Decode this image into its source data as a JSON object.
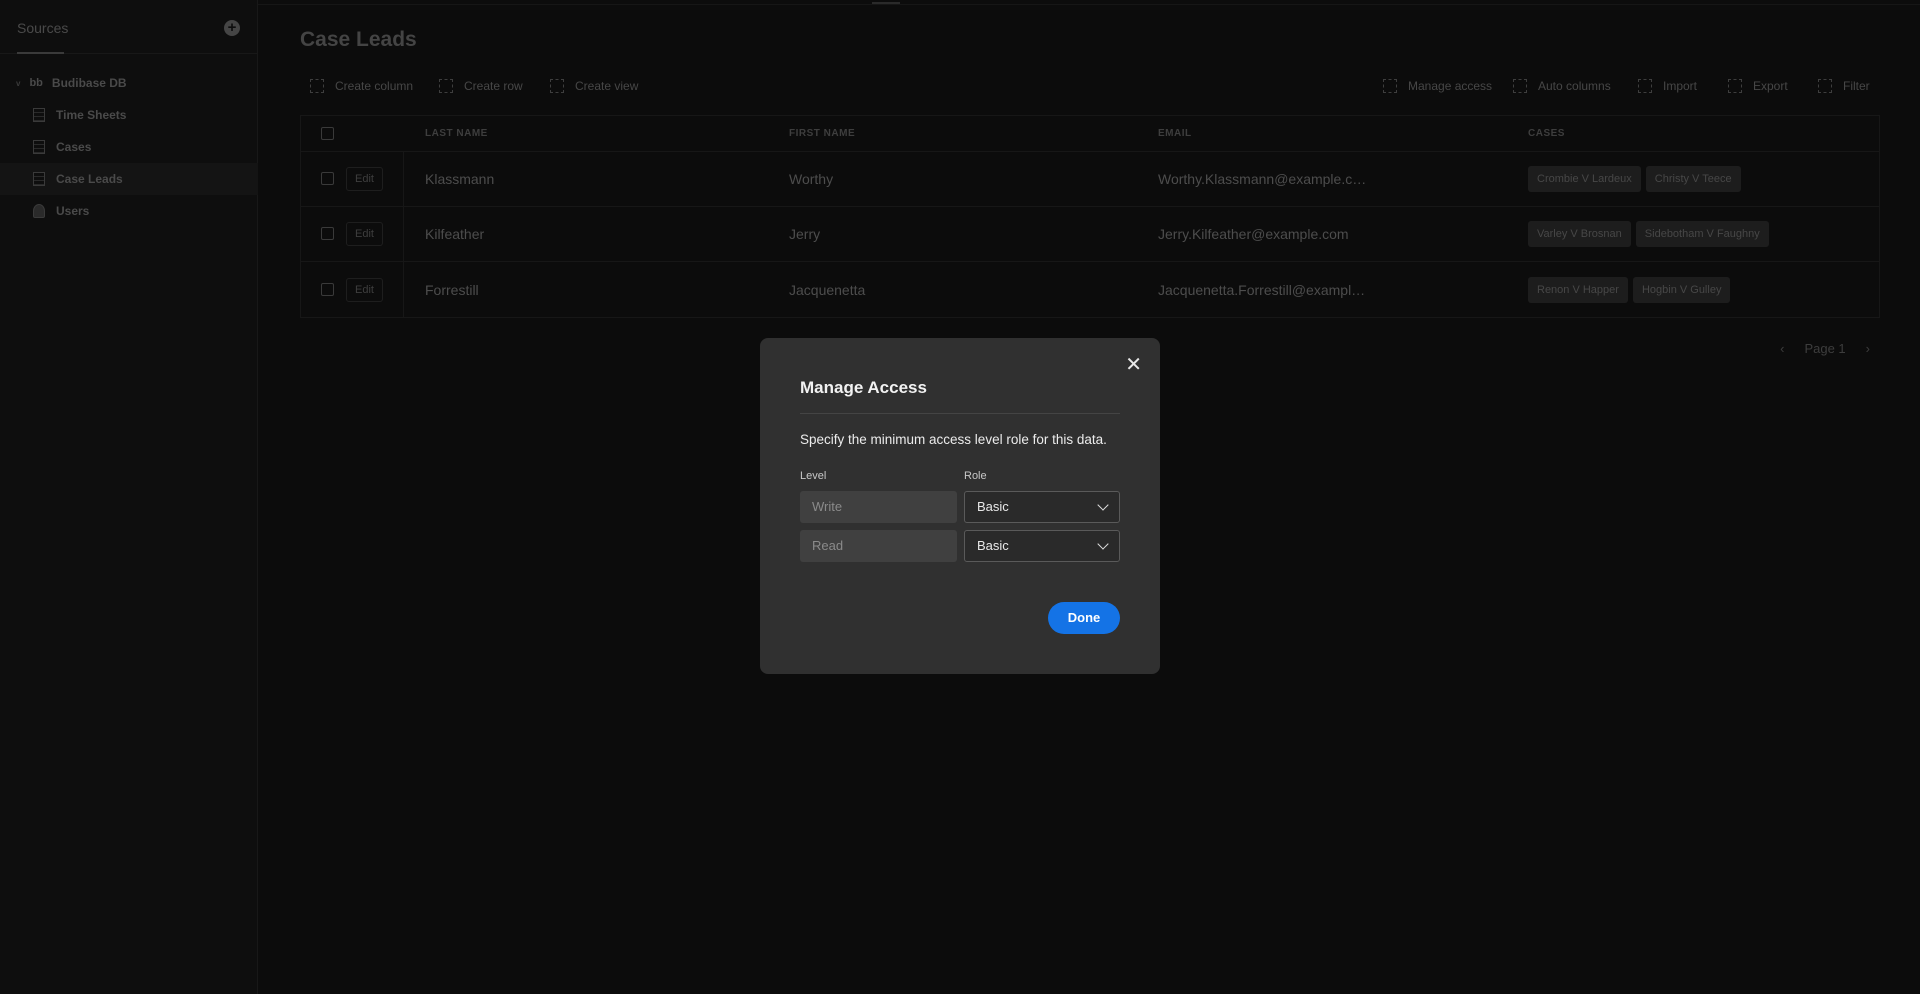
{
  "sidebar": {
    "tab": "Sources",
    "datasource": "Budibase DB",
    "items": [
      {
        "label": "Time Sheets",
        "icon": "table-icon"
      },
      {
        "label": "Cases",
        "icon": "table-icon"
      },
      {
        "label": "Case Leads",
        "icon": "table-icon",
        "selected": true
      },
      {
        "label": "Users",
        "icon": "users-icon"
      }
    ]
  },
  "main": {
    "title": "Case Leads",
    "toolbar_left": [
      "Create column",
      "Create row",
      "Create view"
    ],
    "toolbar_right": [
      "Manage access",
      "Auto columns",
      "Import",
      "Export",
      "Filter"
    ],
    "table": {
      "columns": [
        "LAST NAME",
        "FIRST NAME",
        "EMAIL",
        "CASES"
      ],
      "edit_label": "Edit",
      "rows": [
        {
          "last": "Klassmann",
          "first": "Worthy",
          "email": "Worthy.Klassmann@example.c…",
          "cases": [
            "Crombie V Lardeux",
            "Christy V Teece"
          ]
        },
        {
          "last": "Kilfeather",
          "first": "Jerry",
          "email": "Jerry.Kilfeather@example.com",
          "cases": [
            "Varley V Brosnan",
            "Sidebotham V Faughny"
          ]
        },
        {
          "last": "Forrestill",
          "first": "Jacquenetta",
          "email": "Jacquenetta.Forrestill@exampl…",
          "cases": [
            "Renon V Happer",
            "Hogbin V Gulley"
          ]
        }
      ]
    },
    "pager": "Page 1"
  },
  "modal": {
    "title": "Manage Access",
    "description": "Specify the minimum access level role for this data.",
    "level_label": "Level",
    "role_label": "Role",
    "rows": [
      {
        "level": "Write",
        "role": "Basic"
      },
      {
        "level": "Read",
        "role": "Basic"
      }
    ],
    "done": "Done",
    "accent": "#1473e6"
  }
}
